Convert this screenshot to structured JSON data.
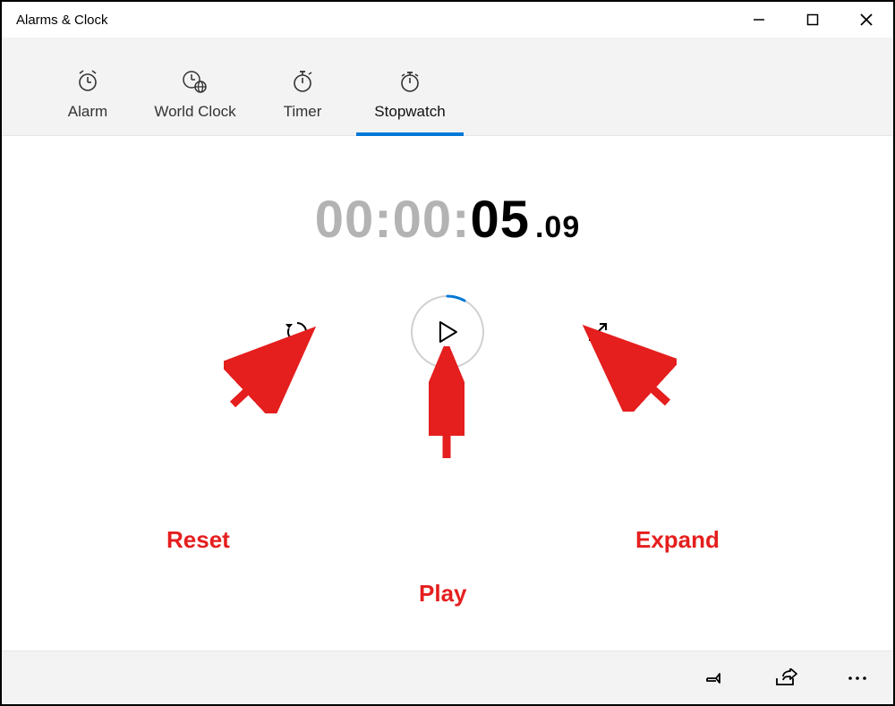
{
  "window": {
    "title": "Alarms & Clock"
  },
  "tabs": [
    {
      "label": "Alarm",
      "icon": "alarm-icon",
      "active": false
    },
    {
      "label": "World Clock",
      "icon": "world-clock-icon",
      "active": false
    },
    {
      "label": "Timer",
      "icon": "timer-icon",
      "active": false
    },
    {
      "label": "Stopwatch",
      "icon": "stopwatch-icon",
      "active": true
    }
  ],
  "stopwatch": {
    "hours": "00",
    "minutes": "00",
    "seconds": "05",
    "fraction": "09",
    "sep": ":"
  },
  "controls": {
    "reset": {
      "icon": "reset-icon"
    },
    "play": {
      "icon": "play-icon"
    },
    "expand": {
      "icon": "expand-icon"
    }
  },
  "annotations": {
    "reset": "Reset",
    "play": "Play",
    "expand": "Expand"
  },
  "bottombar": {
    "pin": {
      "icon": "pin-icon"
    },
    "share": {
      "icon": "share-icon"
    },
    "more": {
      "icon": "more-icon"
    }
  }
}
